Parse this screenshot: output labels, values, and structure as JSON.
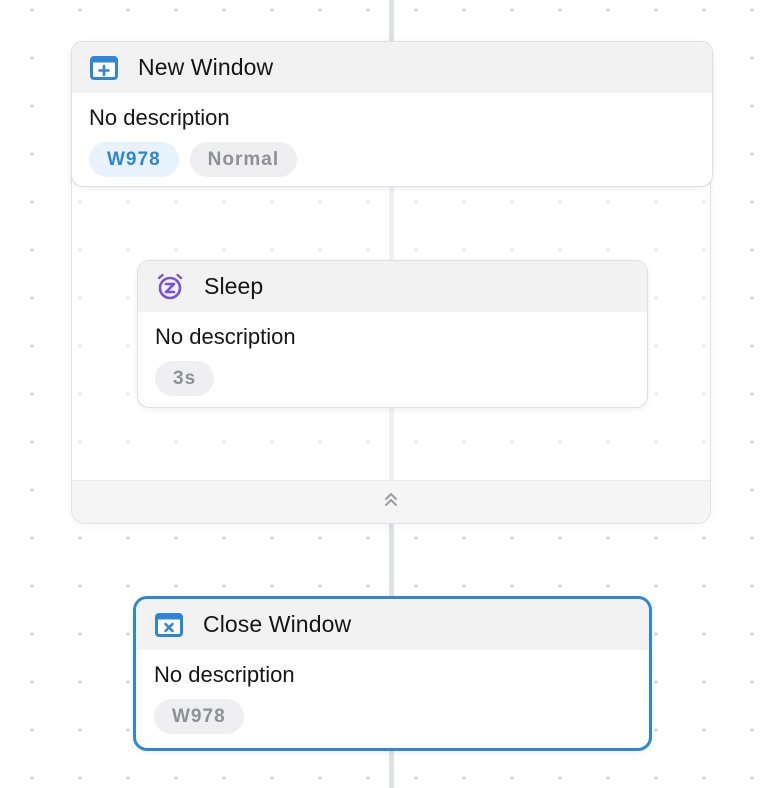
{
  "colors": {
    "accent_blue": "#2f86d6",
    "sleep_purple": "#7b4fe0",
    "badge_gray_text": "#8e9096",
    "connector": "#dfe0e6"
  },
  "group": {
    "name": "New Window",
    "collapse_icon": "chevrons-up-icon",
    "nodes": [
      {
        "id": "new-window",
        "title": "New Window",
        "icon": "window-plus-icon",
        "description": "No description",
        "badges": [
          {
            "label": "W978",
            "style": "blue"
          },
          {
            "label": "Normal",
            "style": "gray"
          }
        ]
      },
      {
        "id": "sleep",
        "title": "Sleep",
        "icon": "alarm-clock-z-icon",
        "description": "No description",
        "badges": [
          {
            "label": "3s",
            "style": "gray"
          }
        ]
      }
    ]
  },
  "close_node": {
    "id": "close-window",
    "title": "Close Window",
    "icon": "window-close-icon",
    "description": "No description",
    "selected": true,
    "badges": [
      {
        "label": "W978",
        "style": "gray"
      }
    ]
  }
}
